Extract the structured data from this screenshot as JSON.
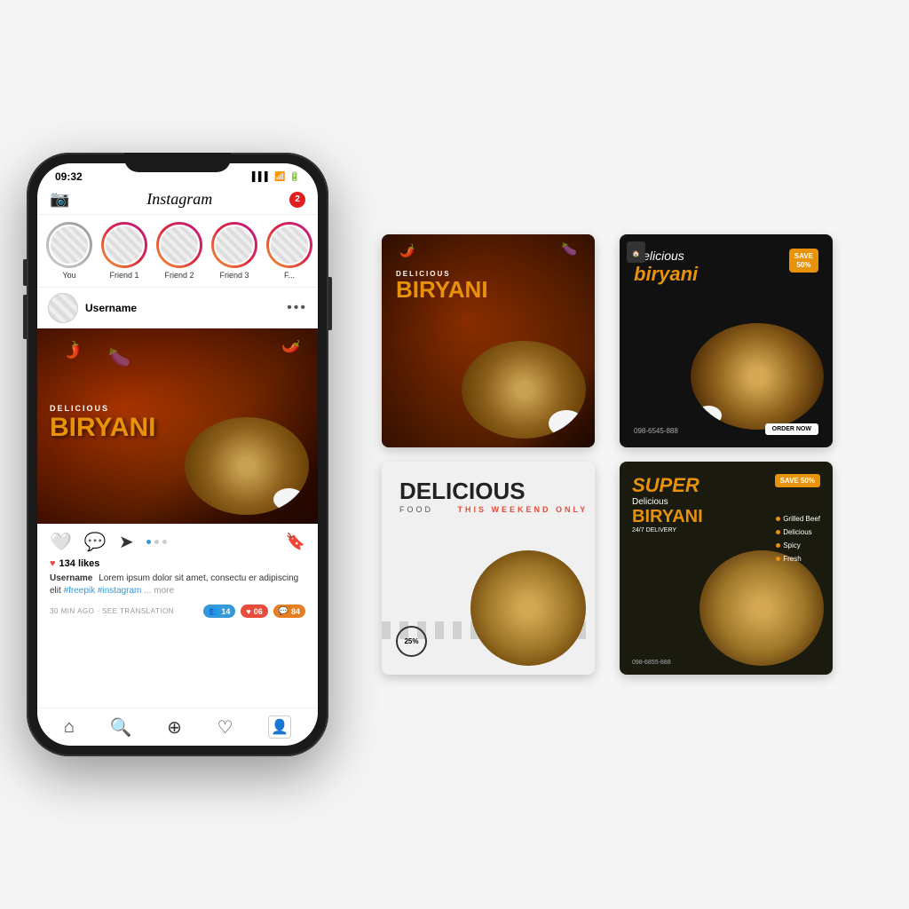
{
  "phone": {
    "status": {
      "time": "09:32",
      "signal": "▌▌▌",
      "wifi": "WiFi",
      "battery": "Battery"
    },
    "header": {
      "camera_label": "📷",
      "title": "Instagram",
      "notification_count": "2"
    },
    "stories": [
      {
        "label": "You",
        "is_you": true
      },
      {
        "label": "Friend 1"
      },
      {
        "label": "Friend 2"
      },
      {
        "label": "Friend 3"
      },
      {
        "label": "F..."
      }
    ],
    "post": {
      "username": "Username",
      "image_title_small": "DELICIOUS",
      "image_title_main": "BIRYANI",
      "likes": "134 likes",
      "caption_user": "Username",
      "caption_text": "Lorem ipsum dolor sit amet, consectu er adipiscing elit ",
      "caption_hashtags": "#freepik #instagram",
      "caption_more": "... more",
      "time": "30 MIN AGO · SEE TRANSLATION",
      "followers_count": "14",
      "hearts_count": "06",
      "comments_count": "84"
    },
    "bottom_nav": {
      "items": [
        "home",
        "search",
        "add",
        "heart",
        "profile"
      ]
    }
  },
  "banners": [
    {
      "id": "banner1",
      "style": "dark-brown",
      "small_text": "DELICIOUS",
      "main_text": "BIRYANI",
      "has_chili": true
    },
    {
      "id": "banner2",
      "style": "black",
      "title1": "Delicious",
      "title2": "biryani",
      "save_text": "SAVE\n50%",
      "phone_number": "098-6545-888",
      "order_btn": "ORDER NOW"
    },
    {
      "id": "banner3",
      "style": "light",
      "main_text": "DELICIOUS",
      "subtitle1": "FOOD",
      "subtitle2": "THIS WEEKEND ONLY"
    },
    {
      "id": "banner4",
      "style": "chalkboard",
      "title1": "SUPER",
      "title2": "Delicious",
      "title3": "BIRYANI",
      "title4": "24/7 DELIVERY",
      "tags": [
        "Grilled Beef",
        "Delicious",
        "Spicy",
        "Fresh"
      ],
      "save": "SAVE 50%",
      "phone": "098-6855-888"
    }
  ]
}
